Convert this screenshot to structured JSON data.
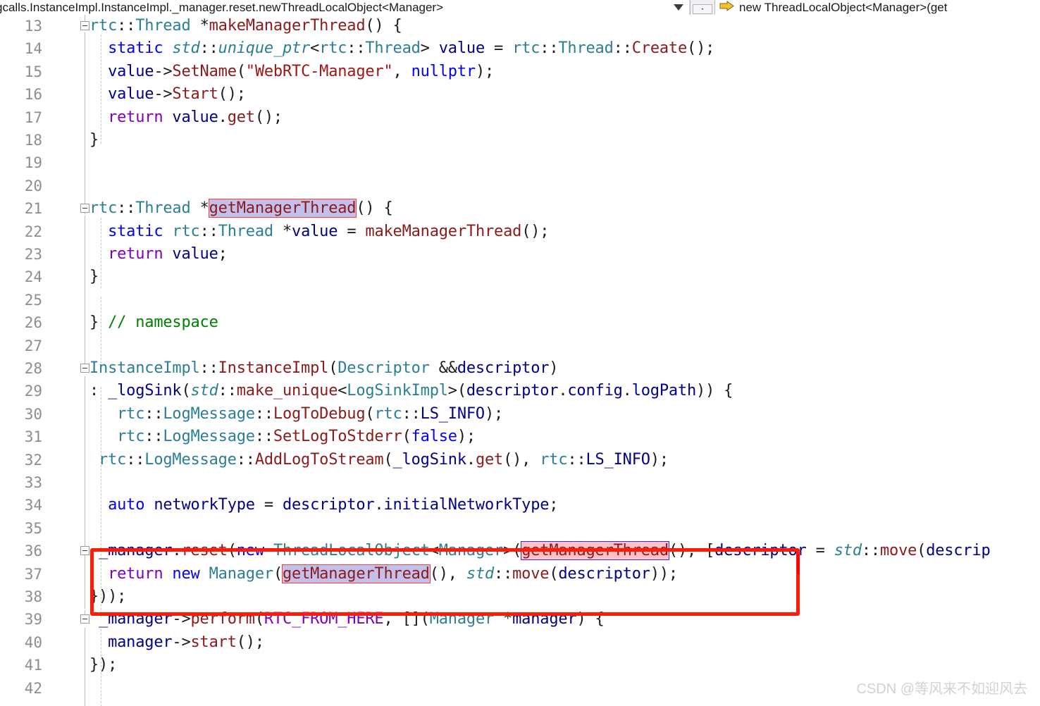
{
  "navbar": {
    "breadcrumb": "gcalls.InstanceImpl.InstanceImpl._manager.reset.newThreadLocalObject<Manager>",
    "breadcrumb_chevron": "▼",
    "spinner_glyph": "▾",
    "member_icon": "method-arrow-icon",
    "member": "new ThreadLocalObject<Manager>(get"
  },
  "editor": {
    "first_line": 13,
    "lines": [
      {
        "n": "13",
        "fold": true,
        "text": "rtc::Thread *makeManagerThread() {"
      },
      {
        "n": "14",
        "fold": false,
        "text": "  static std::unique_ptr<rtc::Thread> value = rtc::Thread::Create();"
      },
      {
        "n": "15",
        "fold": false,
        "text": "  value->SetName(\"WebRTC-Manager\", nullptr);"
      },
      {
        "n": "16",
        "fold": false,
        "text": "  value->Start();"
      },
      {
        "n": "17",
        "fold": false,
        "text": "  return value.get();"
      },
      {
        "n": "18",
        "fold": false,
        "text": "}"
      },
      {
        "n": "19",
        "fold": false,
        "text": ""
      },
      {
        "n": "20",
        "fold": false,
        "text": ""
      },
      {
        "n": "21",
        "fold": true,
        "text": "rtc::Thread *getManagerThread() {"
      },
      {
        "n": "22",
        "fold": false,
        "text": "  static rtc::Thread *value = makeManagerThread();"
      },
      {
        "n": "23",
        "fold": false,
        "text": "  return value;"
      },
      {
        "n": "24",
        "fold": false,
        "text": "}"
      },
      {
        "n": "25",
        "fold": false,
        "text": ""
      },
      {
        "n": "26",
        "fold": false,
        "text": "} // namespace"
      },
      {
        "n": "27",
        "fold": false,
        "text": ""
      },
      {
        "n": "28",
        "fold": true,
        "text": "InstanceImpl::InstanceImpl(Descriptor &&descriptor)"
      },
      {
        "n": "29",
        "fold": false,
        "text": ": _logSink(std::make_unique<LogSinkImpl>(descriptor.config.logPath)) {"
      },
      {
        "n": "30",
        "fold": false,
        "text": "   rtc::LogMessage::LogToDebug(rtc::LS_INFO);"
      },
      {
        "n": "31",
        "fold": false,
        "text": "   rtc::LogMessage::SetLogToStderr(false);"
      },
      {
        "n": "32",
        "fold": false,
        "text": " rtc::LogMessage::AddLogToStream(_logSink.get(), rtc::LS_INFO);"
      },
      {
        "n": "33",
        "fold": false,
        "text": ""
      },
      {
        "n": "34",
        "fold": false,
        "text": "  auto networkType = descriptor.initialNetworkType;"
      },
      {
        "n": "35",
        "fold": false,
        "text": ""
      },
      {
        "n": "36",
        "fold": true,
        "text": "  _manager.reset(new ThreadLocalObject<Manager>(getManagerThread(), [descriptor = std::move(descrip"
      },
      {
        "n": "37",
        "fold": false,
        "text": "   return new Manager(getManagerThread(), std::move(descriptor));"
      },
      {
        "n": "38",
        "fold": false,
        "text": "}));"
      },
      {
        "n": "39",
        "fold": true,
        "text": "  _manager->perform(RTC_FROM_HERE, [](Manager *manager) {"
      },
      {
        "n": "40",
        "fold": false,
        "text": "   manager->start();"
      },
      {
        "n": "41",
        "fold": false,
        "text": "});"
      },
      {
        "n": "42",
        "fold": false,
        "text": ""
      }
    ],
    "highlights": {
      "line21_symbol": "getManagerThread",
      "line36_symbol": "getManagerThread",
      "line37_symbol": "getManagerThread",
      "line21_style": "lavender-with-red-border",
      "line36_style": "pink-with-blue-border",
      "line37_style": "lavender-with-red-border"
    },
    "annotation": {
      "type": "red-rectangle",
      "covers_lines": "36-38"
    }
  },
  "colors": {
    "keyword": "#0000ff",
    "type": "#2b7f95",
    "function": "#8b1a1a",
    "identifier": "#00008b",
    "string": "#a31515",
    "comment": "#008000",
    "macro": "#8000c0",
    "linenumber": "#8d8d8d",
    "annotation_box": "#fc1c08",
    "caret": "#ff0000",
    "highlight_lavender": "#c3c0eb",
    "highlight_pink": "#ffc0c8"
  },
  "watermark": "CSDN @等风来不如迎风去"
}
